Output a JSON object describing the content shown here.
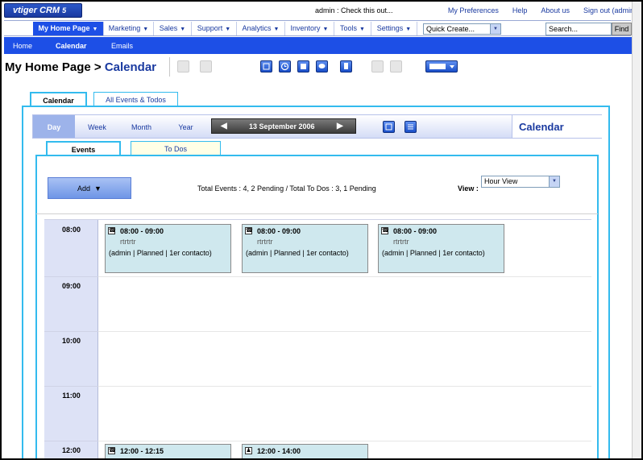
{
  "header": {
    "logo_text": "vtiger CRM",
    "logo_version": "5",
    "message": "admin : Check this out...",
    "links": [
      "My Preferences",
      "Help",
      "About us",
      "Sign out (admin)"
    ]
  },
  "menu": {
    "items": [
      "My Home Page",
      "Marketing",
      "Sales",
      "Support",
      "Analytics",
      "Inventory",
      "Tools",
      "Settings"
    ],
    "quick_create": "Quick Create...",
    "search_placeholder": "Search...",
    "find_label": "Find"
  },
  "submenu": {
    "items": [
      "Home",
      "Calendar",
      "Emails"
    ]
  },
  "page": {
    "section": "My Home Page",
    "separator": ">",
    "module": "Calendar"
  },
  "outer_tabs": [
    "Calendar",
    "All Events & Todos"
  ],
  "calendar": {
    "view_tabs": [
      "Day",
      "Week",
      "Month",
      "Year"
    ],
    "current_date": "13 September 2006",
    "title": "Calendar",
    "inner_tabs": [
      "Events",
      "To Dos"
    ],
    "add_label": "Add",
    "totals": "Total Events : 4, 2 Pending / Total To Dos : 3, 1 Pending",
    "view_label": "View :",
    "view_value": "Hour View",
    "hours": [
      "08:00",
      "09:00",
      "10:00",
      "11:00",
      "12:00"
    ],
    "events": [
      {
        "time": "08:00 - 09:00",
        "subject": "rtrtrtr",
        "info": "(admin | Planned | 1er contacto)",
        "icon": "phone-icon"
      },
      {
        "time": "08:00 - 09:00",
        "subject": "rtrtrtr",
        "info": "(admin | Planned | 1er contacto)",
        "icon": "phone-icon"
      },
      {
        "time": "08:00 - 09:00",
        "subject": "rtrtrtr",
        "info": "(admin | Planned | 1er contacto)",
        "icon": "phone-icon"
      },
      {
        "time": "12:00 - 12:15",
        "subject": "",
        "info": "",
        "icon": "phone-icon"
      },
      {
        "time": "12:00 - 14:00",
        "subject": "",
        "info": "",
        "icon": "meeting-icon"
      }
    ]
  },
  "colors": {
    "accent": "#1d4fe6",
    "tab_border": "#33bbee",
    "event_bg": "#cfe8ee",
    "link": "#1a3aa0"
  }
}
